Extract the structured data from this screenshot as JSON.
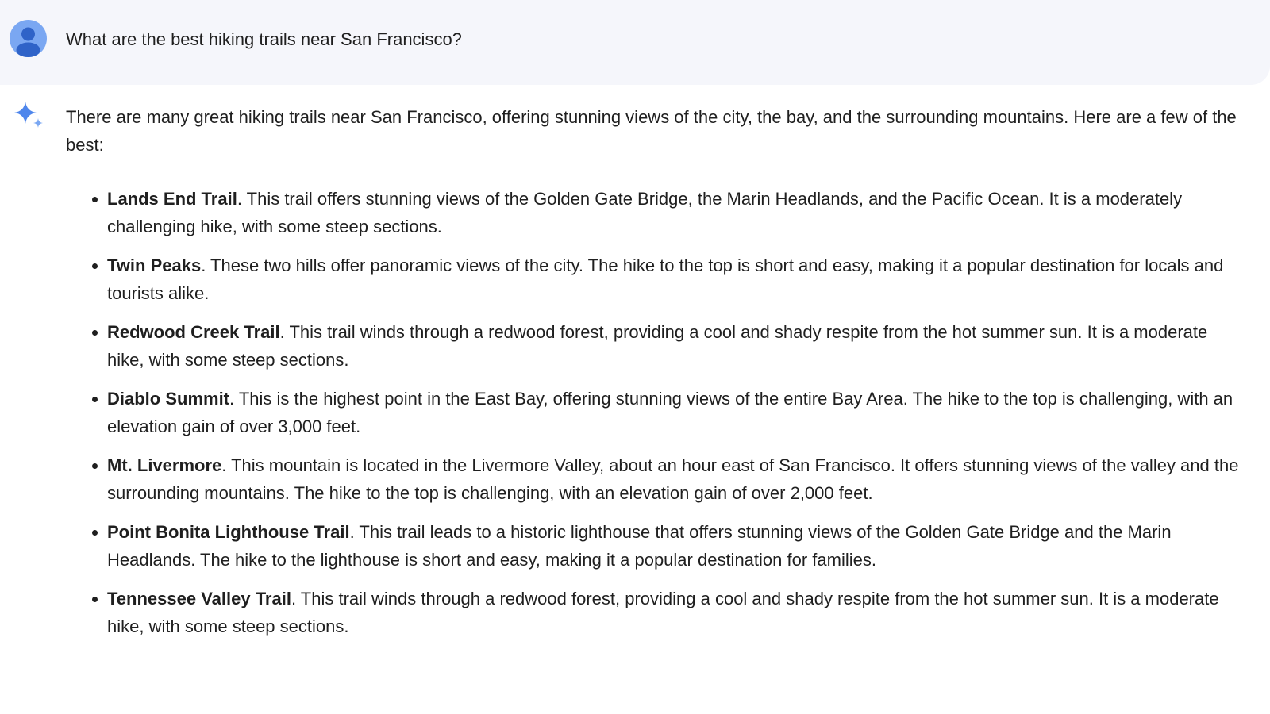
{
  "colors": {
    "user_bg": "#f5f6fb",
    "avatar_bg": "#7aa7f2",
    "avatar_fg": "#2f63c8",
    "sparkle": "#4e86ec",
    "text": "#1f1f1f"
  },
  "user": {
    "avatar_icon": "person-icon",
    "query": "What are the best hiking trails near San Francisco?"
  },
  "model": {
    "icon": "sparkle-icon",
    "intro": "There are many great hiking trails near San Francisco, offering stunning views of the city, the bay, and the surrounding mountains. Here are a few of the best:",
    "trails": [
      {
        "name": "Lands End Trail",
        "description": ". This trail offers stunning views of the Golden Gate Bridge, the Marin Headlands, and the Pacific Ocean. It is a moderately challenging hike, with some steep sections."
      },
      {
        "name": "Twin Peaks",
        "description": ". These two hills offer panoramic views of the city. The hike to the top is short and easy, making it a popular destination for locals and tourists alike."
      },
      {
        "name": "Redwood Creek Trail",
        "description": ". This trail winds through a redwood forest, providing a cool and shady respite from the hot summer sun. It is a moderate hike, with some steep sections."
      },
      {
        "name": "Diablo Summit",
        "description": ". This is the highest point in the East Bay, offering stunning views of the entire Bay Area. The hike to the top is challenging, with an elevation gain of over 3,000 feet."
      },
      {
        "name": "Mt. Livermore",
        "description": ". This mountain is located in the Livermore Valley, about an hour east of San Francisco. It offers stunning views of the valley and the surrounding mountains. The hike to the top is challenging, with an elevation gain of over 2,000 feet."
      },
      {
        "name": "Point Bonita Lighthouse Trail",
        "description": ". This trail leads to a historic lighthouse that offers stunning views of the Golden Gate Bridge and the Marin Headlands. The hike to the lighthouse is short and easy, making it a popular destination for families."
      },
      {
        "name": "Tennessee Valley Trail",
        "description": ". This trail winds through a redwood forest, providing a cool and shady respite from the hot summer sun. It is a moderate hike, with some steep sections."
      }
    ]
  }
}
